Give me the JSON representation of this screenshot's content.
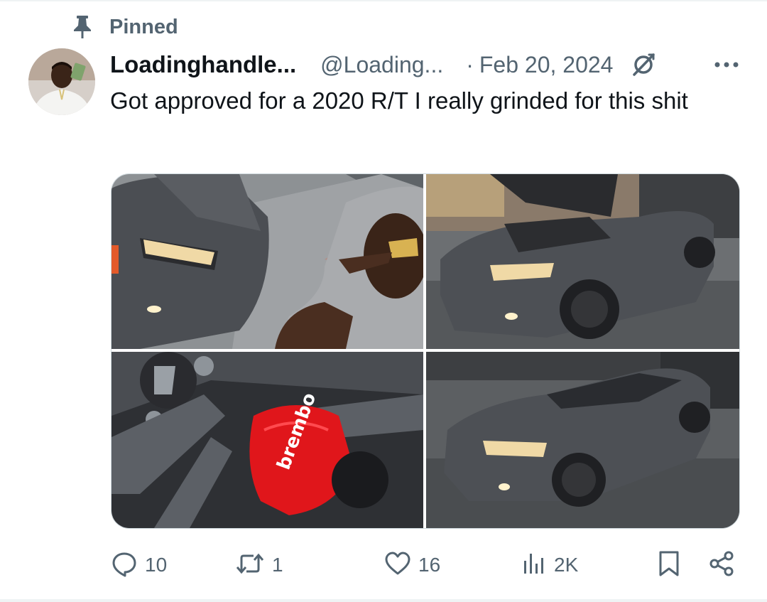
{
  "pinned": {
    "label": "Pinned",
    "icon": "pin-icon"
  },
  "tweet": {
    "display_name": "Loadinghandle...",
    "handle": "@Loading...",
    "separator": "·",
    "date": "Feb 20, 2024",
    "text": "Got approved for a 2020 R/T I really grinded for this shit",
    "media": [
      {
        "name": "photo-car-front-selfie",
        "caliper_text": ""
      },
      {
        "name": "photo-car-hood-open"
      },
      {
        "name": "photo-brembo-caliper",
        "caliper_text": "brembo"
      },
      {
        "name": "photo-car-side-front"
      }
    ]
  },
  "actions": {
    "replies": "10",
    "reposts": "1",
    "likes": "16",
    "views": "2K"
  },
  "icons": [
    "pin-icon",
    "grok-icon",
    "more-icon",
    "reply-icon",
    "repost-icon",
    "like-icon",
    "views-icon",
    "bookmark-icon",
    "share-icon"
  ],
  "colors": {
    "text": "#0f1419",
    "secondary": "#536471",
    "border": "#cfd9de",
    "car": "#4a4d52",
    "caliper": "#e0161b"
  }
}
